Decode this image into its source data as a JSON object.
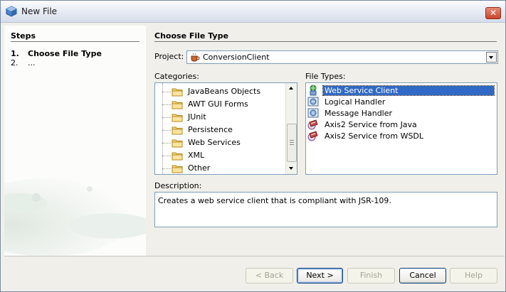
{
  "window": {
    "title": "New File",
    "close_label": "✕"
  },
  "steps": {
    "title": "Steps",
    "items": [
      {
        "num": "1.",
        "label": "Choose File Type"
      },
      {
        "num": "2.",
        "label": "..."
      }
    ]
  },
  "main": {
    "title": "Choose File Type",
    "project_label": "Project:",
    "project_value": "ConversionClient",
    "categories_label": "Categories:",
    "categories": [
      "JavaBeans Objects",
      "AWT GUI Forms",
      "JUnit",
      "Persistence",
      "Web Services",
      "XML",
      "Other"
    ],
    "file_types_label": "File Types:",
    "file_types": [
      {
        "label": "Web Service Client",
        "selected": true
      },
      {
        "label": "Logical Handler"
      },
      {
        "label": "Message Handler"
      },
      {
        "label": "Axis2 Service from Java"
      },
      {
        "label": "Axis2 Service from WSDL"
      }
    ],
    "description_label": "Description:",
    "description": "Creates a web service client that is compliant with JSR-109."
  },
  "buttons": {
    "back": "< Back",
    "next": "Next >",
    "finish": "Finish",
    "cancel": "Cancel",
    "help": "Help"
  }
}
